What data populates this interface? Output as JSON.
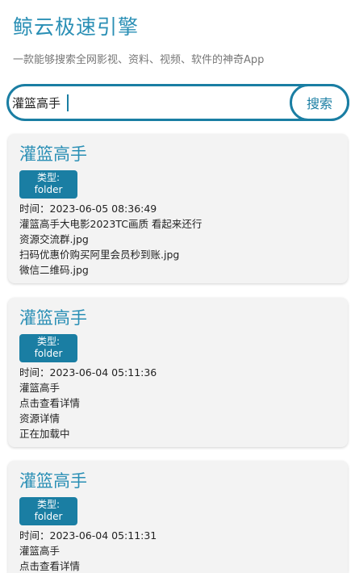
{
  "header": {
    "title": "鲸云极速引擎",
    "subtitle": "一款能够搜索全网影视、资料、视频、软件的神奇App"
  },
  "search": {
    "value": "灌篮高手",
    "button_label": "搜索"
  },
  "colors": {
    "accent": "#1a7ea3",
    "title": "#2a8fb5",
    "card_bg": "#f3f3f3"
  },
  "results": [
    {
      "title": "灌篮高手",
      "type_label": "类型:",
      "type_value": "folder",
      "time": "时间：2023-06-05 08:36:49",
      "lines": [
        "灌篮高手大电影2023TC画质 看起来还行",
        "资源交流群.jpg",
        "扫码优惠价购买阿里会员秒到账.jpg",
        "微信二维码.jpg"
      ]
    },
    {
      "title": "灌篮高手",
      "type_label": "类型:",
      "type_value": "folder",
      "time": "时间：2023-06-04 05:11:36",
      "lines": [
        "灌篮高手",
        "点击查看详情",
        "资源详情",
        "正在加载中"
      ]
    },
    {
      "title": "灌篮高手",
      "type_label": "类型:",
      "type_value": "folder",
      "time": "时间：2023-06-04 05:11:31",
      "lines": [
        "灌篮高手",
        "点击查看详情"
      ]
    }
  ]
}
